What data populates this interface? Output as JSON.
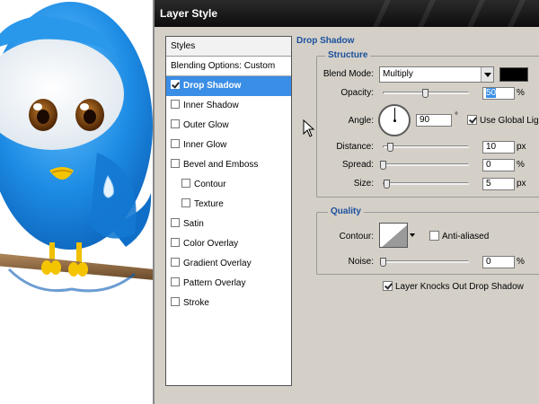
{
  "dialog": {
    "title": "Layer Style"
  },
  "styles_list": {
    "items": [
      {
        "label": "Styles",
        "type": "header",
        "checkbox": false,
        "checked": false,
        "selected": false,
        "indent": 0
      },
      {
        "label": "Blending Options: Custom",
        "type": "sep",
        "checkbox": false,
        "checked": false,
        "selected": false,
        "indent": 0
      },
      {
        "label": "Drop Shadow",
        "type": "item",
        "checkbox": true,
        "checked": true,
        "selected": true,
        "indent": 0
      },
      {
        "label": "Inner Shadow",
        "type": "item",
        "checkbox": true,
        "checked": false,
        "selected": false,
        "indent": 0
      },
      {
        "label": "Outer Glow",
        "type": "item",
        "checkbox": true,
        "checked": false,
        "selected": false,
        "indent": 0
      },
      {
        "label": "Inner Glow",
        "type": "item",
        "checkbox": true,
        "checked": false,
        "selected": false,
        "indent": 0
      },
      {
        "label": "Bevel and Emboss",
        "type": "item",
        "checkbox": true,
        "checked": false,
        "selected": false,
        "indent": 0
      },
      {
        "label": "Contour",
        "type": "item",
        "checkbox": true,
        "checked": false,
        "selected": false,
        "indent": 1
      },
      {
        "label": "Texture",
        "type": "item",
        "checkbox": true,
        "checked": false,
        "selected": false,
        "indent": 1
      },
      {
        "label": "Satin",
        "type": "item",
        "checkbox": true,
        "checked": false,
        "selected": false,
        "indent": 0
      },
      {
        "label": "Color Overlay",
        "type": "item",
        "checkbox": true,
        "checked": false,
        "selected": false,
        "indent": 0
      },
      {
        "label": "Gradient Overlay",
        "type": "item",
        "checkbox": true,
        "checked": false,
        "selected": false,
        "indent": 0
      },
      {
        "label": "Pattern Overlay",
        "type": "item",
        "checkbox": true,
        "checked": false,
        "selected": false,
        "indent": 0
      },
      {
        "label": "Stroke",
        "type": "item",
        "checkbox": true,
        "checked": false,
        "selected": false,
        "indent": 0
      }
    ]
  },
  "panel": {
    "section_title": "Drop Shadow",
    "structure": {
      "legend": "Structure",
      "blend_mode_label": "Blend Mode:",
      "blend_mode_value": "Multiply",
      "shadow_color": "#000000",
      "opacity_label": "Opacity:",
      "opacity_value": "50",
      "opacity_unit": "%",
      "angle_label": "Angle:",
      "angle_value": "90",
      "angle_unit": "°",
      "use_global_light_label": "Use Global Light",
      "use_global_light_checked": true,
      "distance_label": "Distance:",
      "distance_value": "10",
      "distance_unit": "px",
      "spread_label": "Spread:",
      "spread_value": "0",
      "spread_unit": "%",
      "size_label": "Size:",
      "size_value": "5",
      "size_unit": "px"
    },
    "quality": {
      "legend": "Quality",
      "contour_label": "Contour:",
      "anti_aliased_label": "Anti-aliased",
      "anti_aliased_checked": false,
      "noise_label": "Noise:",
      "noise_value": "0",
      "noise_unit": "%"
    },
    "knockout_label": "Layer Knocks Out Drop Shadow",
    "knockout_checked": true
  },
  "colors": {
    "dialog_bg": "#d4d0c8",
    "selection": "#3a8ee6",
    "section_title": "#1a4f9c",
    "bird_blue": "#1e8fe6"
  }
}
